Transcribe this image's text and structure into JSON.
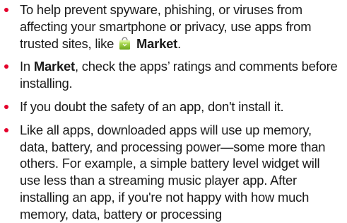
{
  "accent_color": "#e4002b",
  "tips": [
    {
      "before": "To help prevent spyware, phishing, or viruses from affecting your smartphone or privacy, use apps from trusted sites, like",
      "icon": "market-bag-icon",
      "bold": "Market",
      "after": "."
    },
    {
      "before": "In",
      "bold": "Market",
      "after": ", check the apps’ ratings and comments before installing."
    },
    {
      "text": "If you doubt the safety of an app, don't install it."
    },
    {
      "text": "Like all apps, downloaded apps will use up memory, data, battery, and processing power—some more than others. For example, a simple battery level widget will use less than a streaming music player app. After installing an app, if you're not happy with how much memory, data, battery or processing"
    }
  ]
}
